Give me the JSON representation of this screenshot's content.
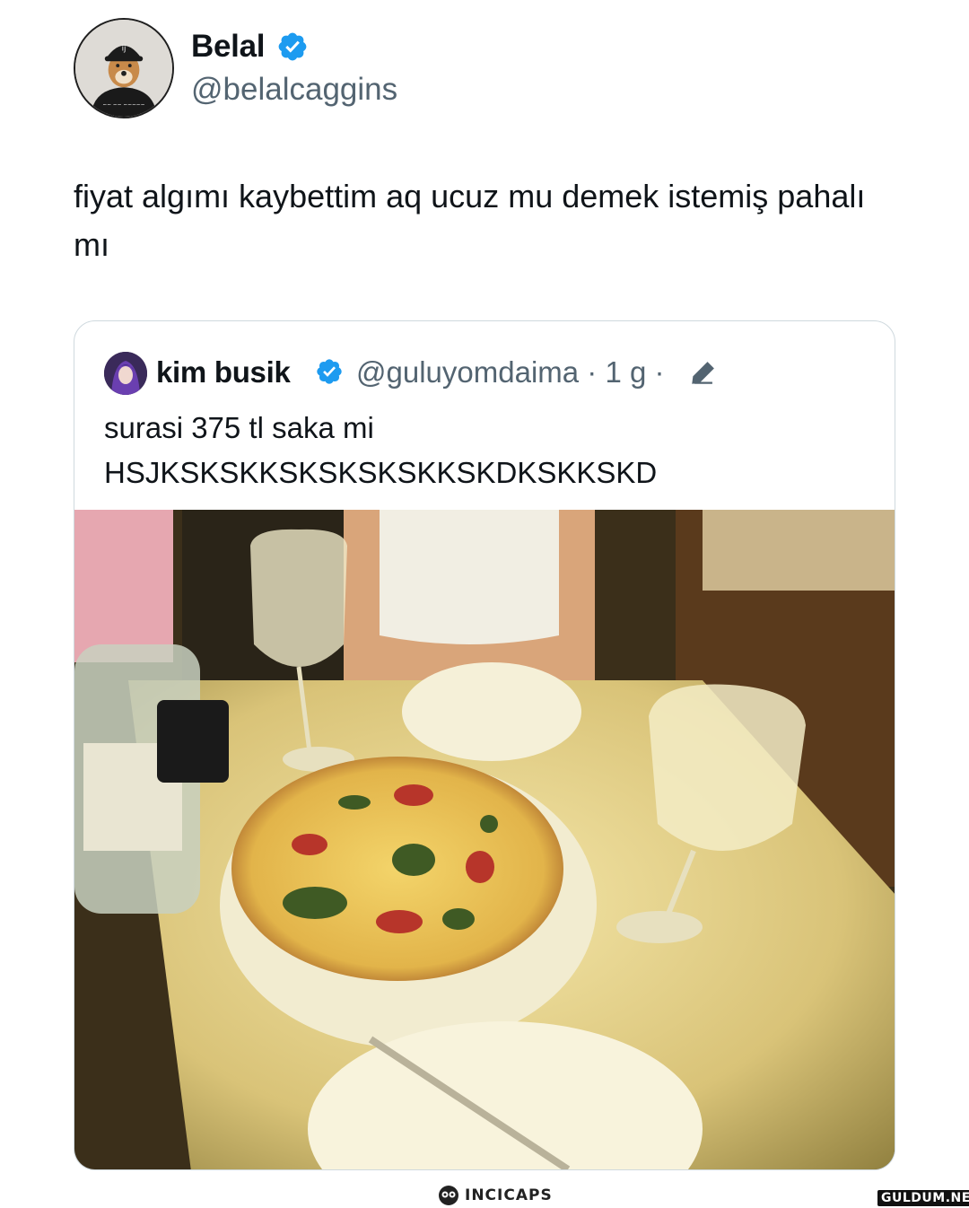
{
  "tweet": {
    "author": {
      "display_name": "Belal",
      "handle": "@belalcaggins",
      "verified": true
    },
    "text": "fiyat algımı kaybettim aq ucuz mu demek istemiş pahalı mı"
  },
  "quoted_tweet": {
    "author": {
      "display_name": "kim busik",
      "handle": "@guluyomdaima",
      "verified": true
    },
    "meta": "@guluyomdaima · 1 g ·",
    "text_lines": [
      "surasi 375 tl saka mi",
      "HSJKSKSKKSKSKSKSKKSKDKSKKSKD"
    ],
    "media": "photo-pizza-wine-table"
  },
  "watermarks": {
    "left": "INCICAPS",
    "right": "GULDUM.NET"
  },
  "colors": {
    "verified_blue": "#1d9bf0",
    "handle_gray": "#536471",
    "border": "#cfd9de"
  },
  "icons": [
    "verified-badge-icon",
    "edit-pencil-icon",
    "owl-logo-icon"
  ]
}
